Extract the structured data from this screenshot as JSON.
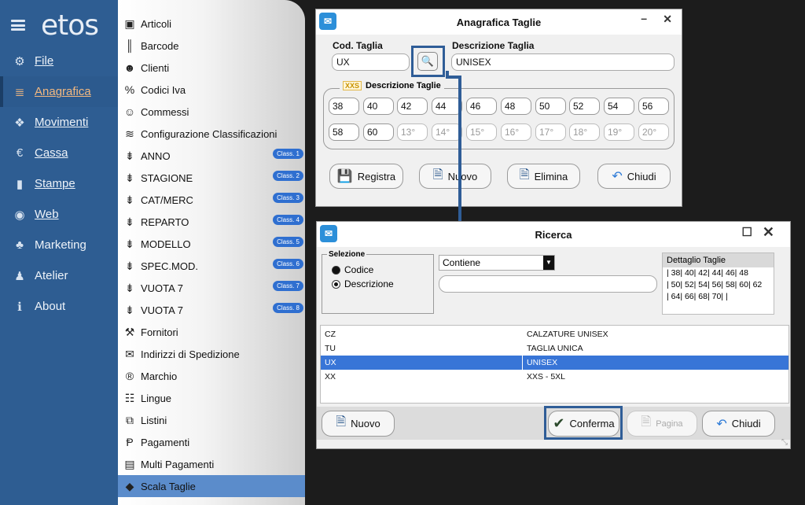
{
  "app": {
    "logo": "etos"
  },
  "sidebar": {
    "items": [
      {
        "label": "File",
        "icon": "⚙",
        "underline": true
      },
      {
        "label": "Anagrafica",
        "icon": "≣",
        "underline": true,
        "active": true
      },
      {
        "label": "Movimenti",
        "icon": "❖",
        "underline": true
      },
      {
        "label": "Cassa",
        "icon": "€",
        "underline": true
      },
      {
        "label": "Stampe",
        "icon": "▮",
        "underline": true
      },
      {
        "label": "Web",
        "icon": "◉",
        "underline": true
      },
      {
        "label": "Marketing",
        "icon": "♣",
        "underline": false
      },
      {
        "label": "Atelier",
        "icon": "♟",
        "underline": false
      },
      {
        "label": "About",
        "icon": "ℹ",
        "underline": false
      }
    ]
  },
  "submenu": {
    "items": [
      {
        "label": "Articoli",
        "icon": "▣"
      },
      {
        "label": "Barcode",
        "icon": "║"
      },
      {
        "label": "Clienti",
        "icon": "☻"
      },
      {
        "label": "Codici Iva",
        "icon": "%"
      },
      {
        "label": "Commessi",
        "icon": "☺"
      },
      {
        "label": "Configurazione Classificazioni",
        "icon": "≋"
      },
      {
        "label": "ANNO",
        "icon": "⇟",
        "badge": "Class. 1"
      },
      {
        "label": "STAGIONE",
        "icon": "⇟",
        "badge": "Class. 2"
      },
      {
        "label": "CAT/MERC",
        "icon": "⇟",
        "badge": "Class. 3"
      },
      {
        "label": "REPARTO",
        "icon": "⇟",
        "badge": "Class. 4"
      },
      {
        "label": "MODELLO",
        "icon": "⇟",
        "badge": "Class. 5"
      },
      {
        "label": "SPEC.MOD.",
        "icon": "⇟",
        "badge": "Class. 6"
      },
      {
        "label": "VUOTA 7",
        "icon": "⇟",
        "badge": "Class. 7"
      },
      {
        "label": "VUOTA 7",
        "icon": "⇟",
        "badge": "Class. 8"
      },
      {
        "label": "Fornitori",
        "icon": "⚒"
      },
      {
        "label": "Indirizzi di Spedizione",
        "icon": "✉"
      },
      {
        "label": "Marchio",
        "icon": "®"
      },
      {
        "label": "Lingue",
        "icon": "☷"
      },
      {
        "label": "Listini",
        "icon": "⧉"
      },
      {
        "label": "Pagamenti",
        "icon": "Ᵽ"
      },
      {
        "label": "Multi Pagamenti",
        "icon": "▤"
      },
      {
        "label": "Scala Taglie",
        "icon": "◆",
        "active": true
      }
    ]
  },
  "anagrafica": {
    "title": "Anagrafica Taglie",
    "cod_label": "Cod. Taglia",
    "cod_value": "UX",
    "desc_label": "Descrizione Taglia",
    "desc_value": "UNISEX",
    "group_badge": "XXS",
    "group_label": "Descrizione Taglie",
    "sizes_row1": [
      "38",
      "40",
      "42",
      "44",
      "46",
      "48",
      "50",
      "52",
      "54",
      "56"
    ],
    "sizes_row2": [
      "58",
      "60",
      "13°",
      "14°",
      "15°",
      "16°",
      "17°",
      "18°",
      "19°",
      "20°"
    ],
    "buttons": {
      "registra": "Registra",
      "nuovo": "Nuovo",
      "elimina": "Elimina",
      "chiudi": "Chiudi"
    }
  },
  "ricerca": {
    "title": "Ricerca",
    "selezione_label": "Selezione",
    "opt_codice": "Codice",
    "opt_descrizione": "Descrizione",
    "match_mode": "Contiene",
    "search_value": "",
    "dettaglio_header": "Dettaglio Taglie",
    "dettaglio_lines": [
      "| 38| 40| 42| 44| 46| 48",
      "| 50| 52| 54| 56| 58| 60| 62",
      "| 64| 66| 68| 70| |"
    ],
    "rows": [
      {
        "code": "CZ",
        "desc": "CALZATURE UNISEX"
      },
      {
        "code": "TU",
        "desc": "TAGLIA UNICA"
      },
      {
        "code": "UX",
        "desc": "UNISEX",
        "selected": true
      },
      {
        "code": "XX",
        "desc": "XXS - 5XL"
      }
    ],
    "buttons": {
      "nuovo": "Nuovo",
      "conferma": "Conferma",
      "pagina": "Pagina",
      "chiudi": "Chiudi"
    }
  },
  "colors": {
    "sidebar": "#2e5d92",
    "accent": "#f2b880",
    "selection": "#3875d7",
    "highlight": "#2f5d97"
  }
}
